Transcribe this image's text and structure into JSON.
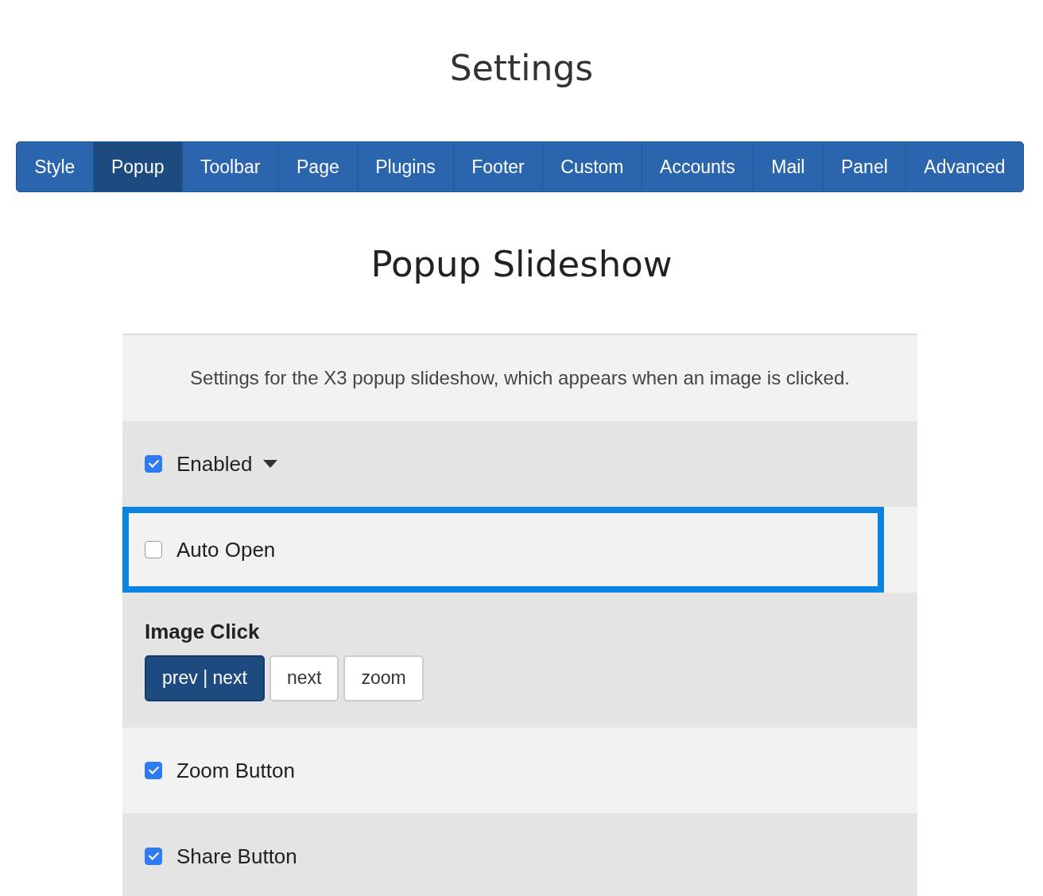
{
  "title": "Settings",
  "tabs": [
    {
      "label": "Style",
      "selected": false
    },
    {
      "label": "Popup",
      "selected": true
    },
    {
      "label": "Toolbar",
      "selected": false
    },
    {
      "label": "Page",
      "selected": false
    },
    {
      "label": "Plugins",
      "selected": false
    },
    {
      "label": "Footer",
      "selected": false
    },
    {
      "label": "Custom",
      "selected": false
    },
    {
      "label": "Accounts",
      "selected": false
    },
    {
      "label": "Mail",
      "selected": false
    },
    {
      "label": "Panel",
      "selected": false
    },
    {
      "label": "Advanced",
      "selected": false
    }
  ],
  "heading": "Popup Slideshow",
  "description": "Settings for the X3 popup slideshow, which appears when an image is clicked.",
  "rows": [
    {
      "kind": "checkbox",
      "label": "Enabled",
      "checked": true,
      "expandable": true,
      "focused": false
    },
    {
      "kind": "checkbox",
      "label": "Auto Open",
      "checked": false,
      "expandable": false,
      "focused": true
    },
    {
      "kind": "buttons",
      "label": "Image Click",
      "options": [
        {
          "label": "prev | next",
          "selected": true
        },
        {
          "label": "next",
          "selected": false
        },
        {
          "label": "zoom",
          "selected": false
        }
      ]
    },
    {
      "kind": "checkbox",
      "label": "Zoom Button",
      "checked": true,
      "expandable": false,
      "focused": false
    },
    {
      "kind": "checkbox",
      "label": "Share Button",
      "checked": true,
      "expandable": false,
      "focused": false
    }
  ]
}
